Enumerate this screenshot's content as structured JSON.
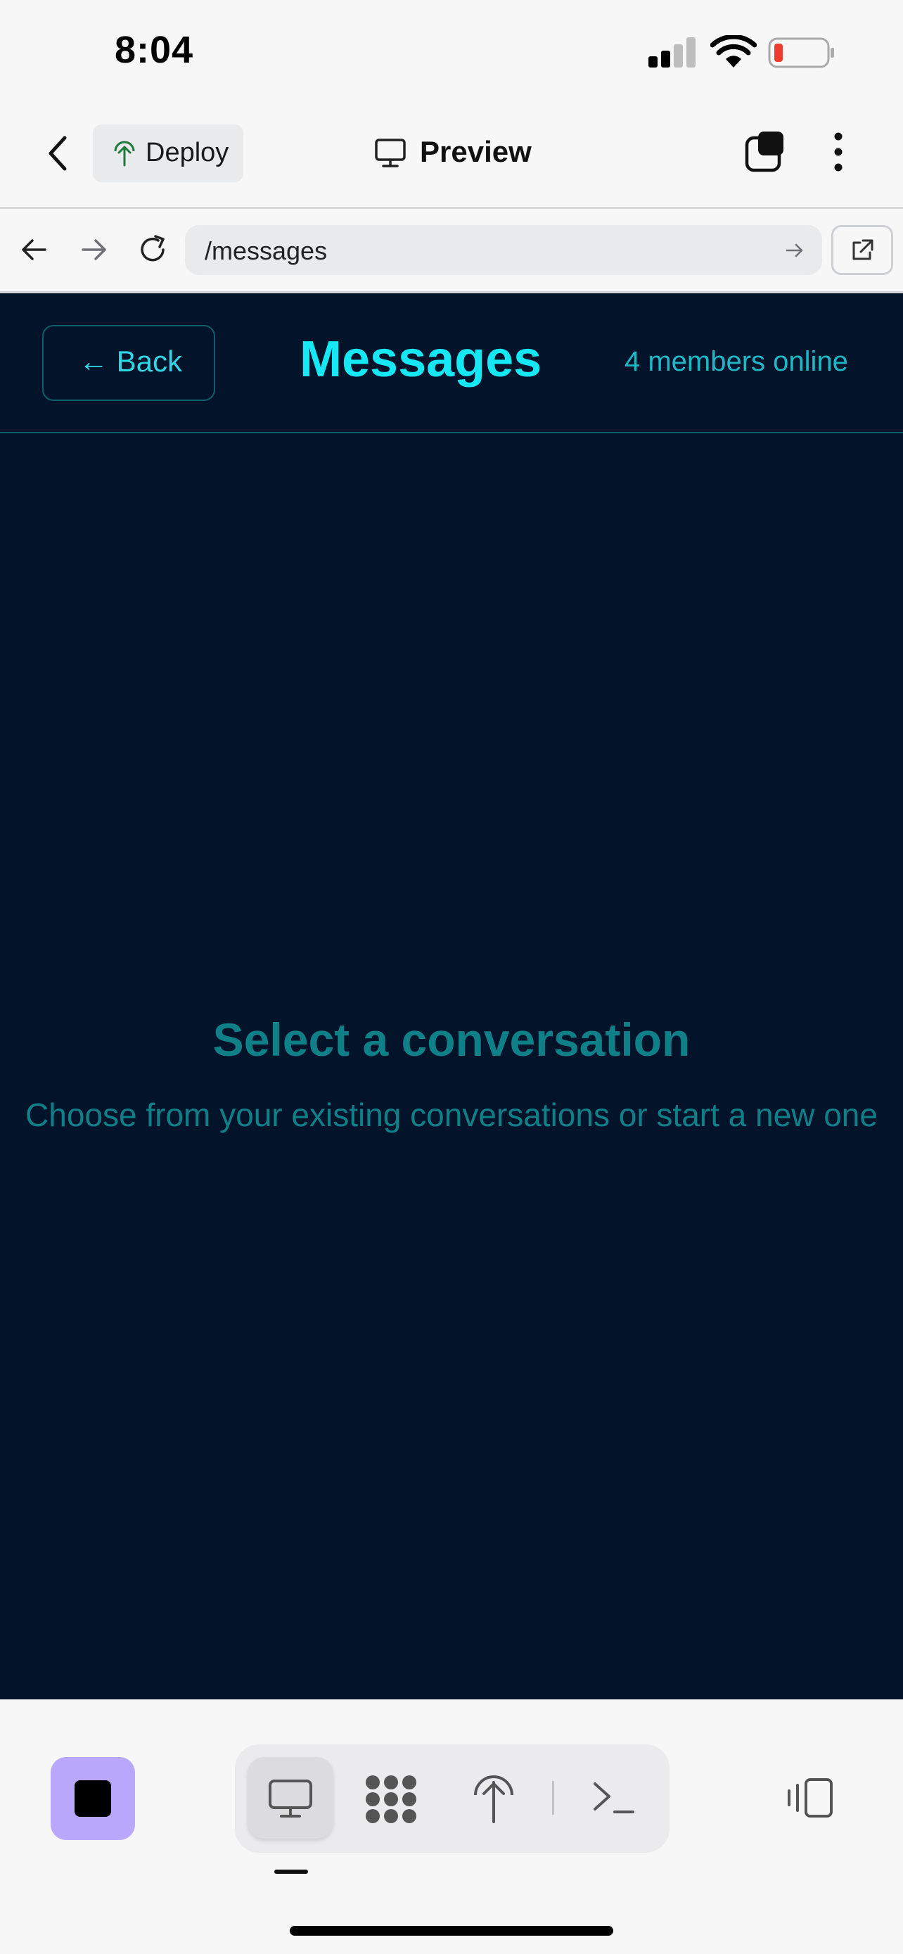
{
  "status_bar": {
    "time": "8:04"
  },
  "top_bar": {
    "deploy_label": "Deploy",
    "preview_label": "Preview"
  },
  "browser": {
    "url": "/messages"
  },
  "app": {
    "back_label": "← Back",
    "title": "Messages",
    "online_status": "4 members online",
    "empty_title": "Select a conversation",
    "empty_subtitle": "Choose from your existing conversations or start a new one"
  },
  "colors": {
    "app_background": "#02132a",
    "accent_cyan": "#16e7f4",
    "muted_teal": "#0f7f88",
    "stop_button": "#b9a7fb"
  },
  "icons": {
    "nav_back": "chevron-left-icon",
    "deploy": "deploy-tree-icon",
    "preview": "monitor-icon",
    "tabs": "tabs-stack-icon",
    "menu": "more-vertical-icon",
    "browser_back": "arrow-left-icon",
    "browser_forward": "arrow-right-icon",
    "reload": "reload-icon",
    "go": "arrow-right-small-icon",
    "open_external": "external-link-icon",
    "stop": "stop-icon",
    "bottom_tabs": [
      "monitor-icon",
      "nodes-icon",
      "deploy-icon",
      "terminal-icon"
    ],
    "side_panel": "side-panel-icon"
  }
}
